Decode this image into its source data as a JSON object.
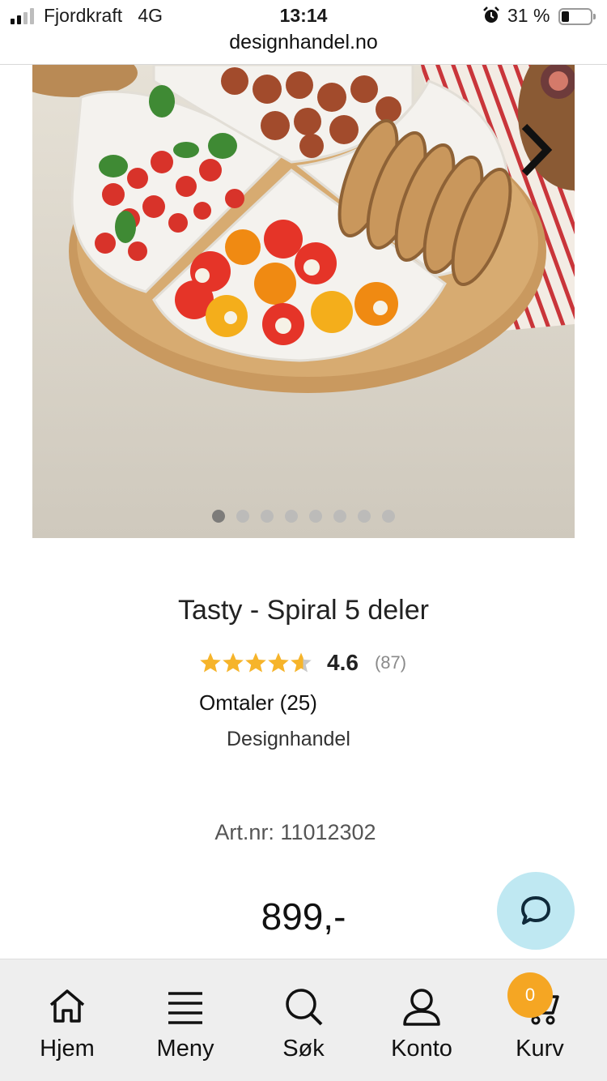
{
  "status_bar": {
    "carrier": "Fjordkraft",
    "network": "4G",
    "time": "13:14",
    "battery_percent": "31 %"
  },
  "browser": {
    "url": "designhandel.no"
  },
  "gallery": {
    "image_count": 8,
    "active_index": 0,
    "next_icon": "chevron-right-icon"
  },
  "product": {
    "title": "Tasty - Spiral 5 deler",
    "rating": "4.6",
    "rating_value": 4.6,
    "rating_count": "(87)",
    "reviews_link": "Omtaler (25)",
    "brand": "Designhandel",
    "article_number": "Art.nr: 11012302",
    "price": "899,-"
  },
  "chat": {
    "icon": "chat-bubble-icon",
    "color": "#bfe8f2"
  },
  "bottom_nav": {
    "items": [
      {
        "label": "Hjem",
        "icon": "home-icon"
      },
      {
        "label": "Meny",
        "icon": "menu-icon"
      },
      {
        "label": "Søk",
        "icon": "search-icon"
      },
      {
        "label": "Konto",
        "icon": "user-icon"
      },
      {
        "label": "Kurv",
        "icon": "cart-icon"
      }
    ],
    "cart_count": "0",
    "badge_color": "#f5a623"
  },
  "colors": {
    "star": "#f6b42a",
    "star_empty": "#c8c8c8"
  }
}
